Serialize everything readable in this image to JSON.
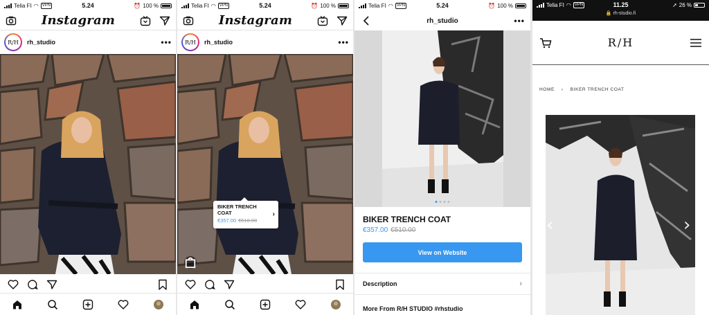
{
  "statusbar": {
    "carrier": "Telia FI",
    "vpn": "VPN",
    "time": "5.24",
    "battery": "100 %"
  },
  "instagram": {
    "logo": "Instagram",
    "username": "rh_studio",
    "avatar_text": "R/H",
    "more": "•••"
  },
  "tag": {
    "name": "BIKER TRENCH COAT",
    "price_new": "€357.00",
    "price_old": "€510.00"
  },
  "product_page": {
    "title": "rh_studio",
    "name": "BIKER TRENCH COAT",
    "price_new": "€357.00",
    "price_old": "€510.00",
    "button": "View on Website",
    "description": "Description",
    "more_from": "More From R/H STUDIO  #rhstudio"
  },
  "website": {
    "carrier": "Telia FI",
    "vpn": "VPN",
    "time": "11.25",
    "battery": "26 %",
    "url": "rh-studio.fi",
    "logo": "R/H",
    "breadcrumb_home": "HOME",
    "breadcrumb_sep": "›",
    "breadcrumb_current": "BIKER TRENCH COAT"
  },
  "colors": {
    "accent": "#3897f0",
    "text": "#111111"
  }
}
